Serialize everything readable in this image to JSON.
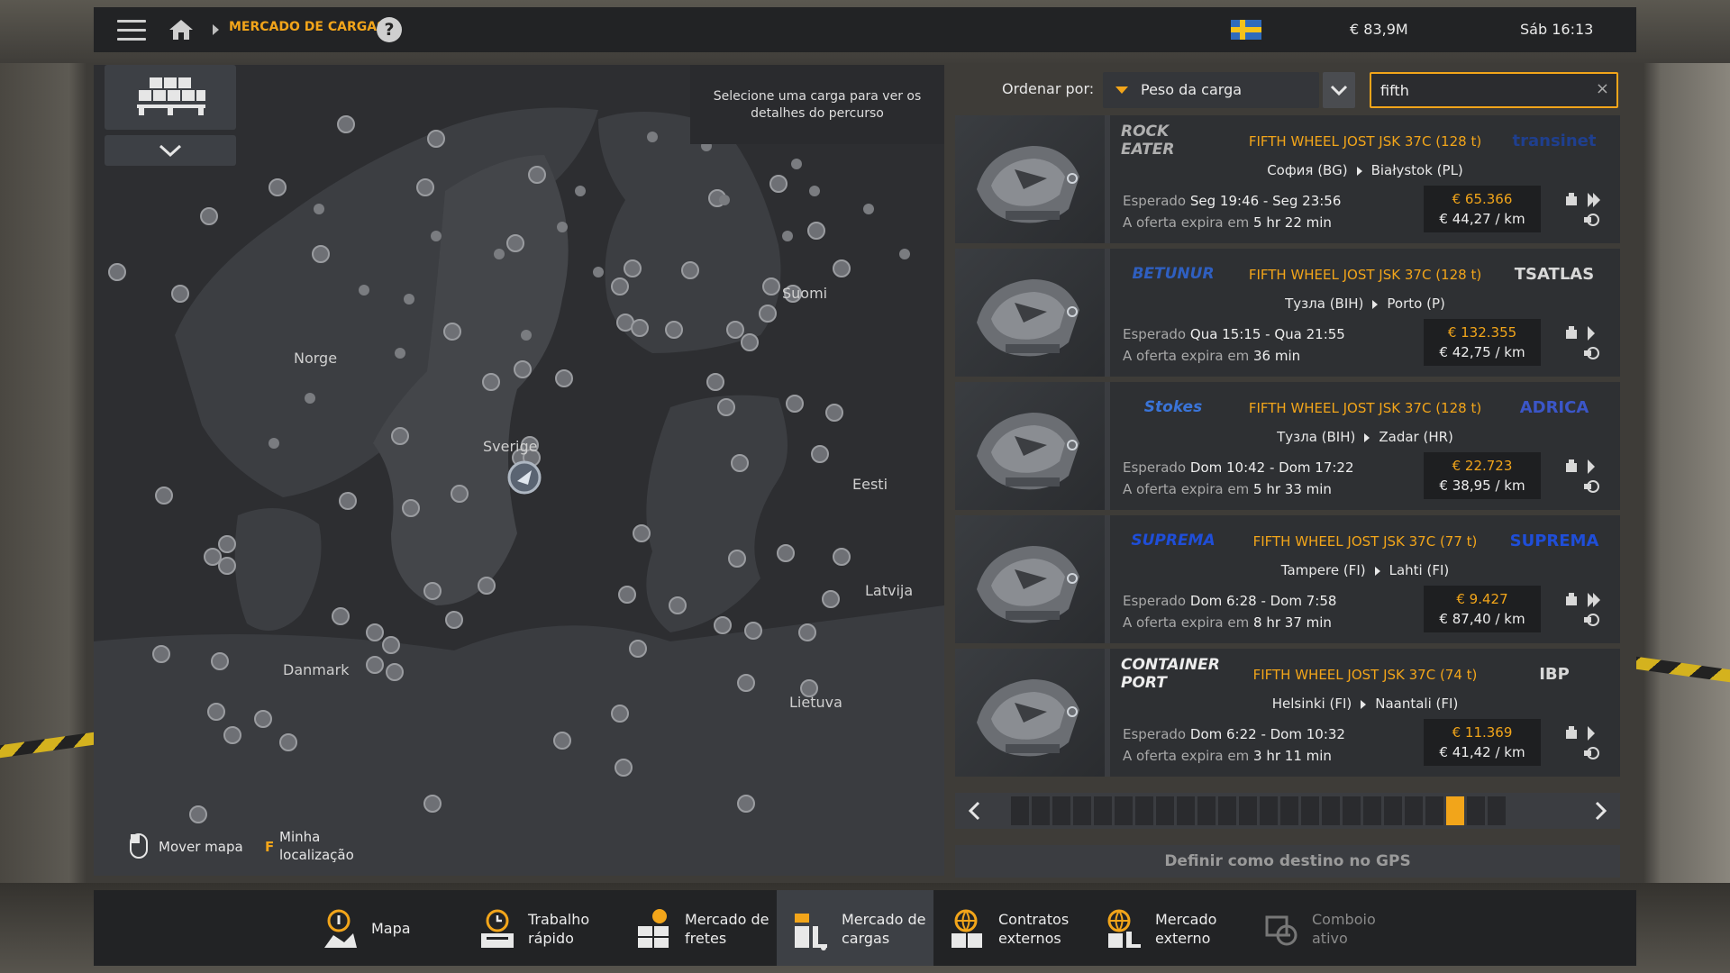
{
  "topbar": {
    "breadcrumb": "MERCADO DE CARGAS",
    "help": "?",
    "money": "€ 83,9M",
    "clock": "Sáb 16:13"
  },
  "map": {
    "hint": "Selecione uma carga para ver os detalhes do percurso",
    "labels": {
      "norge": "Norge",
      "sverige": "Sverige",
      "suomi": "Suomi",
      "eesti": "Eesti",
      "latvija": "Latvija",
      "danmark": "Danmark",
      "lietuva": "Lietuva"
    },
    "controls": {
      "move": "Mover mapa",
      "locate_key": "F",
      "locate_line1": "Minha",
      "locate_line2": "localização"
    }
  },
  "sort": {
    "label": "Ordenar por:",
    "selected": "Peso da carga"
  },
  "search": {
    "value": "fifth",
    "clear": "×"
  },
  "jobs": [
    {
      "cargo": "FIFTH WHEEL JOST JSK 37C (128 t)",
      "from": "София (BG)",
      "to": "Białystok (PL)",
      "expected_label": "Esperado",
      "expected": "Seg 19:46 - Seg 23:56",
      "offer_label": "A oferta expira em",
      "offer": "5 hr 22 min",
      "price": "€ 65.366",
      "per_km": "€ 44,27 / km",
      "logo_left": "ROCK EATER",
      "logo_right": "transinet",
      "logo_left_color": "#b0b0b0",
      "logo_right_color": "#1f3f8f"
    },
    {
      "cargo": "FIFTH WHEEL JOST JSK 37C (128 t)",
      "from": "Тузла (BIH)",
      "to": "Porto (P)",
      "expected_label": "Esperado",
      "expected": "Qua 15:15 - Qua 21:55",
      "offer_label": "A oferta expira em",
      "offer": "36 min",
      "price": "€ 132.355",
      "per_km": "€ 42,75 / km",
      "logo_left": "BETUNUR",
      "logo_right": "TSATLAS",
      "logo_left_color": "#2f5fc0",
      "logo_right_color": "#d8d8d8"
    },
    {
      "cargo": "FIFTH WHEEL JOST JSK 37C (128 t)",
      "from": "Тузла (BIH)",
      "to": "Zadar (HR)",
      "expected_label": "Esperado",
      "expected": "Dom 10:42 - Dom 17:22",
      "offer_label": "A oferta expira em",
      "offer": "5 hr 33 min",
      "price": "€ 22.723",
      "per_km": "€ 38,95 / km",
      "logo_left": "Stokes",
      "logo_right": "ADRICA",
      "logo_left_color": "#3a74d8",
      "logo_right_color": "#3b56c8"
    },
    {
      "cargo": "FIFTH WHEEL JOST JSK 37C (77 t)",
      "from": "Tampere (FI)",
      "to": "Lahti (FI)",
      "expected_label": "Esperado",
      "expected": "Dom 6:28 - Dom 7:58",
      "offer_label": "A oferta expira em",
      "offer": "8 hr 37 min",
      "price": "€ 9.427",
      "per_km": "€ 87,40 / km",
      "logo_left": "SUPREMA",
      "logo_right": "SUPREMA",
      "logo_left_color": "#1f4ed8",
      "logo_right_color": "#1f4ed8"
    },
    {
      "cargo": "FIFTH WHEEL JOST JSK 37C (74 t)",
      "from": "Helsinki (FI)",
      "to": "Naantali (FI)",
      "expected_label": "Esperado",
      "expected": "Dom 6:22 - Dom 10:32",
      "offer_label": "A oferta expira em",
      "offer": "3 hr 11 min",
      "price": "€ 11.369",
      "per_km": "€ 41,42 / km",
      "logo_left": "CONTAINER PORT",
      "logo_right": "IBP",
      "logo_left_color": "#ececec",
      "logo_right_color": "#d8d8d8"
    }
  ],
  "pager": {
    "pages": 24,
    "current": 22
  },
  "gps_button": "Definir como destino no GPS",
  "bottom_tabs": [
    {
      "line1": "Mapa",
      "line2": "",
      "icon": "map-icon"
    },
    {
      "line1": "Trabalho",
      "line2": "rápido",
      "icon": "quick-job-icon"
    },
    {
      "line1": "Mercado de",
      "line2": "fretes",
      "icon": "freight-market-icon"
    },
    {
      "line1": "Mercado de",
      "line2": "cargas",
      "icon": "cargo-market-icon"
    },
    {
      "line1": "Contratos",
      "line2": "externos",
      "icon": "external-contracts-icon"
    },
    {
      "line1": "Mercado",
      "line2": "externo",
      "icon": "external-market-icon"
    },
    {
      "line1": "Comboio",
      "line2": "ativo",
      "icon": "convoy-icon"
    }
  ],
  "colors": {
    "accent": "#f2a51a",
    "panel": "#2e3033",
    "bar": "#222325"
  }
}
